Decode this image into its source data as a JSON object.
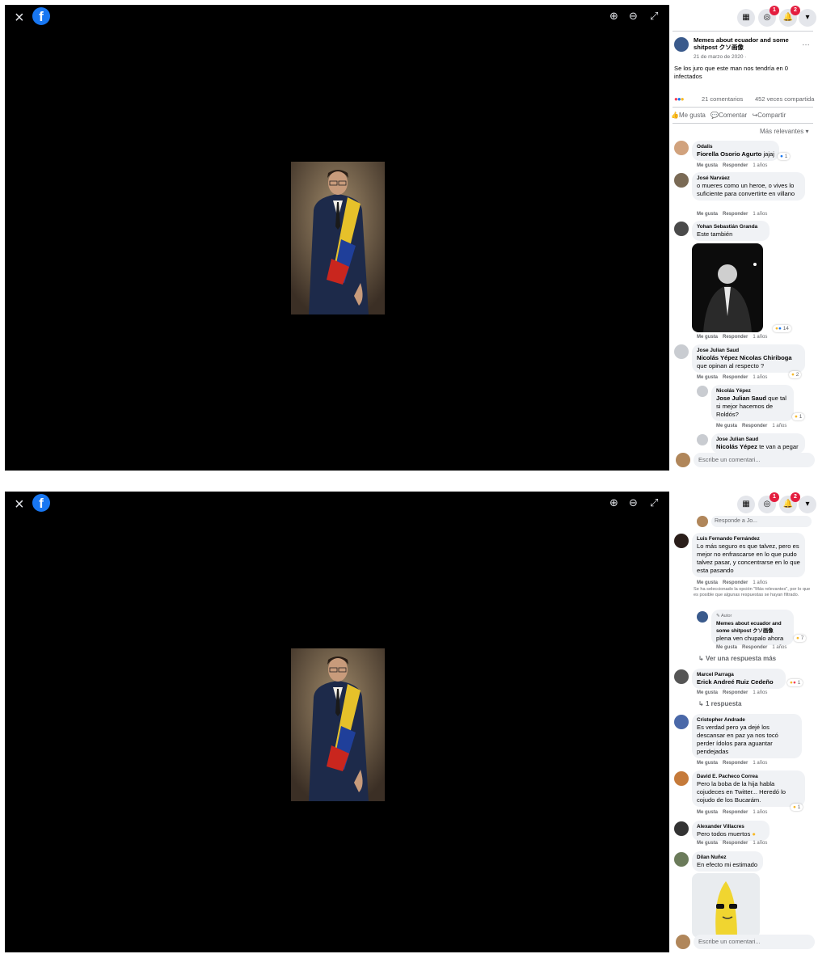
{
  "viewer": {
    "close_glyph": "×",
    "logo_letter": "f",
    "zoom_in_glyph": "⊕",
    "zoom_out_glyph": "⊖",
    "fullscreen_glyph": "⤢"
  },
  "topbar": {
    "messenger_badge": "1",
    "notifications_badge": "2"
  },
  "post": {
    "page_name": "Memes about ecuador and some shitpost クソ画像",
    "date": "21 de marzo de 2020 ·",
    "text": "Se los juro que este man nos tendría en 0 infectados",
    "comments_count": "21 comentarios",
    "shares_count": "452 veces compartida",
    "like_label": "Me gusta",
    "comment_label": "Comentar",
    "share_label": "Compartir",
    "sort_label": "Más relevantes"
  },
  "comment_actions": {
    "like": "Me gusta",
    "reply": "Responder",
    "ago": "1 años"
  },
  "comments_top": [
    {
      "name": "Odalis",
      "tag": "Fiorella Osorio Agurto",
      "text": "jajaj",
      "reaction": "1"
    },
    {
      "name": "José Narváez",
      "text": "o mueres como un heroe, o vives lo suficiente para convertirte en villano"
    },
    {
      "name": "Yohan Sebastián Granda",
      "text": "Este también",
      "reaction": "14"
    },
    {
      "name": "Jose Julian Saud",
      "tag": "Nicolás Yépez Nicolas Chiriboga",
      "text": "que opinan al respecto ?",
      "reaction": "2"
    },
    {
      "name": "Nicolás Yépez",
      "tag": "Jose Julian Saud",
      "text": "que tal si mejor hacemos de Roldós?",
      "reaction": "1"
    },
    {
      "name": "Jose Julian Saud",
      "tag": "Nicolás Yépez",
      "text": "te van a pegar"
    }
  ],
  "comments_bottom": {
    "reply_placeholder": "Responde a Jo...",
    "c1": {
      "name": "Luis Fernando Fernández",
      "text": "Lo más seguro es que talvez, pero es mejor no enfrascarse en lo que pudo talvez pasar, y concentrarse en lo que esta pasando"
    },
    "filter_note": "Se ha seleccionado la opción \"Más relevantes\", por lo que es posible que algunas respuestas se hayan filtrado.",
    "author_badge": "Autor",
    "c2": {
      "name": "Memes about ecuador and some shitpost クソ画像",
      "text": "plena ven chupalo ahora",
      "reaction": "7"
    },
    "more_replies": "Ver una respuesta más",
    "c3": {
      "name": "Marcel Parraga",
      "tag": "Erick Andreé Ruiz Cedeño",
      "reaction": "1"
    },
    "one_reply": "1 respuesta",
    "c4": {
      "name": "Cristopher Andrade",
      "text": "Es verdad pero ya dejé los descansar en paz ya nos tocó perder ídolos para aguantar pendejadas"
    },
    "c5": {
      "name": "David E. Pacheco Correa",
      "text": "Pero la boba de la hija habla cojudeces en Twitter... Heredó lo cojudo de los Bucarám.",
      "reaction": "1"
    },
    "c6": {
      "name": "Alexander Villacres",
      "text": "Pero todos muertos"
    },
    "c7": {
      "name": "Dilan Nuñez",
      "text": "En efecto mi estimado"
    }
  },
  "composer": {
    "placeholder": "Escribe un comentari..."
  },
  "colors": {
    "brand_blue": "#1877f2",
    "badge_red": "#e41e3f",
    "bubble_gray": "#f0f2f5"
  }
}
